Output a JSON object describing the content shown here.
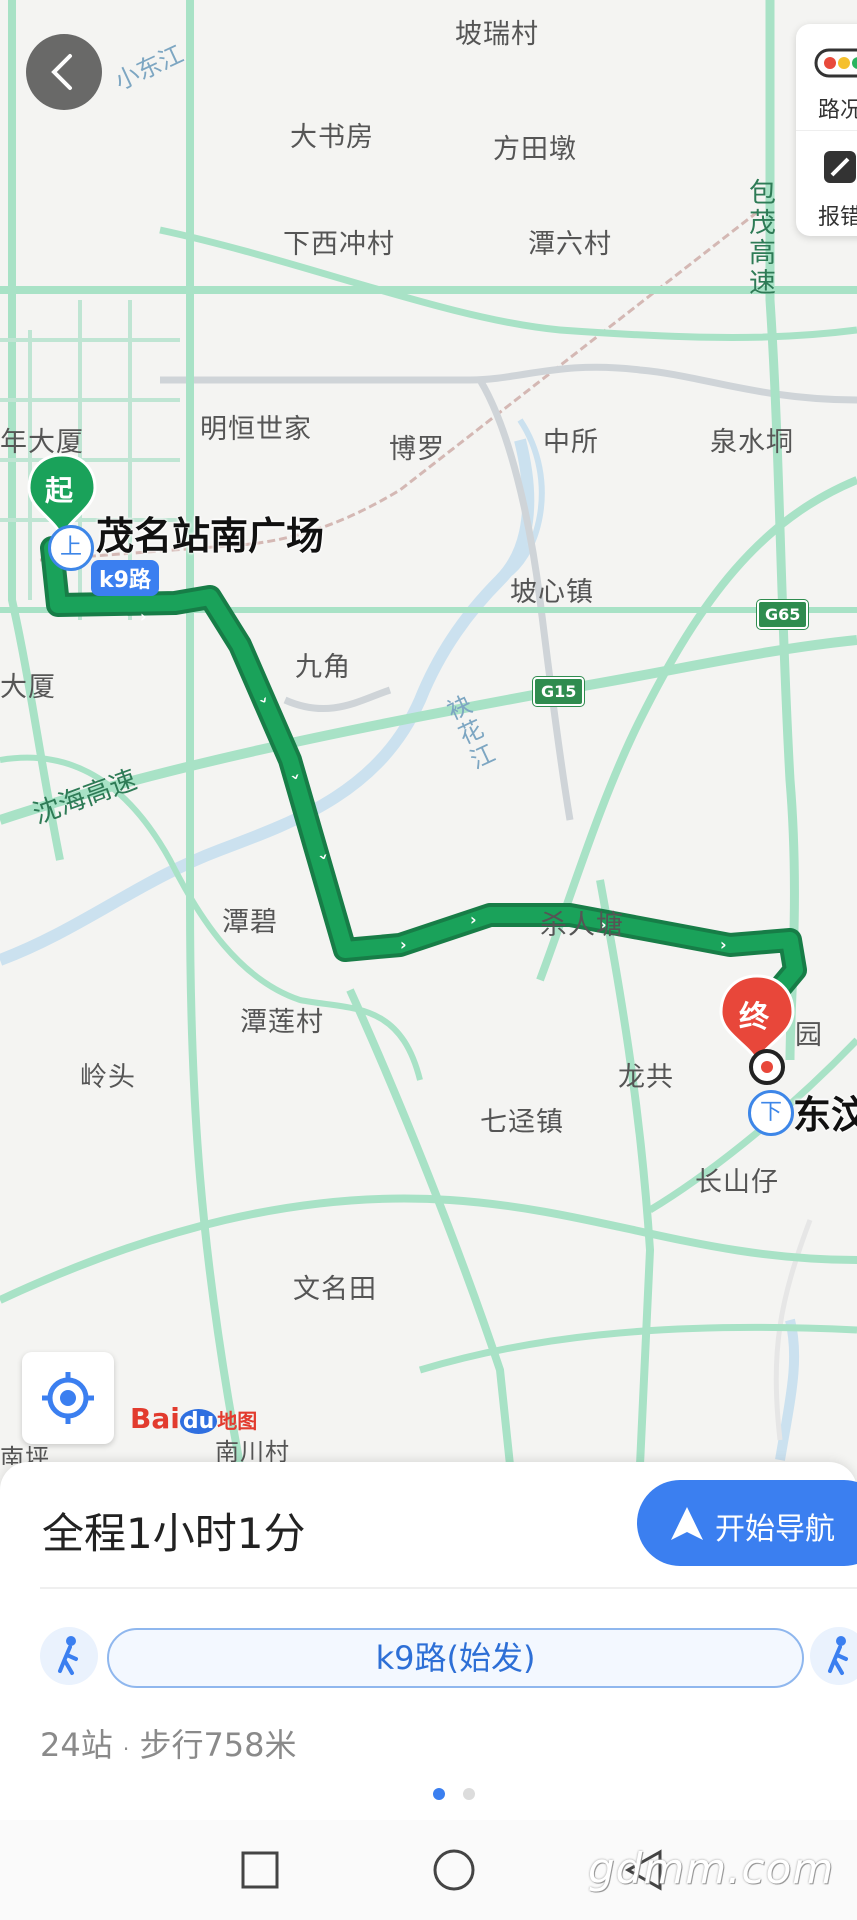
{
  "map": {
    "places": {
      "poruicun": "坡瑞村",
      "xiaodongjiang": "小东江",
      "dashufang": "大书房",
      "fangtiandun": "方田墩",
      "xiaxichongcun": "下西冲村",
      "tanliucun": "潭六村",
      "baomao": "包茂高速",
      "nianda": "年大厦",
      "minghengshijia": "明恒世家",
      "boluo": "博罗",
      "zhongsuo": "中所",
      "quanshuiduo": "泉水垌",
      "poxinzhen": "坡心镇",
      "jiujiao": "九角",
      "dasha": "大厦",
      "shenhai": "沈海高速",
      "luohuajiang": "袂花江",
      "tanbi": "潭碧",
      "sharentang": "杀人塘",
      "tanliancun": "潭莲村",
      "lingtou": "岭头",
      "qijingzhen": "七迳镇",
      "longgong": "龙共",
      "yuan": "园",
      "changshanzai": "长山仔",
      "wenmingtian": "文名田",
      "nanchuancun": "南川村",
      "nanping": "南坪"
    },
    "shields": {
      "g65": "G65",
      "g15": "G15"
    },
    "side_panel": {
      "traffic_label": "路况",
      "report_label": "报错"
    },
    "start_marker": "起",
    "end_marker": "终",
    "board_icon": "上",
    "alight_icon": "下",
    "start_station": "茂名站南广场",
    "end_station": "东汶",
    "line_tag": "k9路",
    "logo": {
      "bai": "Bai",
      "du": "du",
      "ditu": "地图"
    },
    "colors": {
      "route": "#1aa25a",
      "road": "#a8e2c6",
      "start": "#1aa25a",
      "end": "#e8473a",
      "accent": "#3b7ff0"
    }
  },
  "sheet": {
    "total_time": "全程1小时1分",
    "nav_button": "开始导航",
    "route_pill": "k9路(始发)",
    "meta_stops": "24站",
    "meta_sep": "·",
    "meta_walk": "步行758米",
    "watermark": "gdmm.com"
  },
  "icons": [
    "back-icon",
    "traffic-icon",
    "report-icon",
    "locate-icon",
    "walk-icon",
    "navigate-arrow-icon",
    "square-icon",
    "circle-icon",
    "triangle-icon"
  ]
}
